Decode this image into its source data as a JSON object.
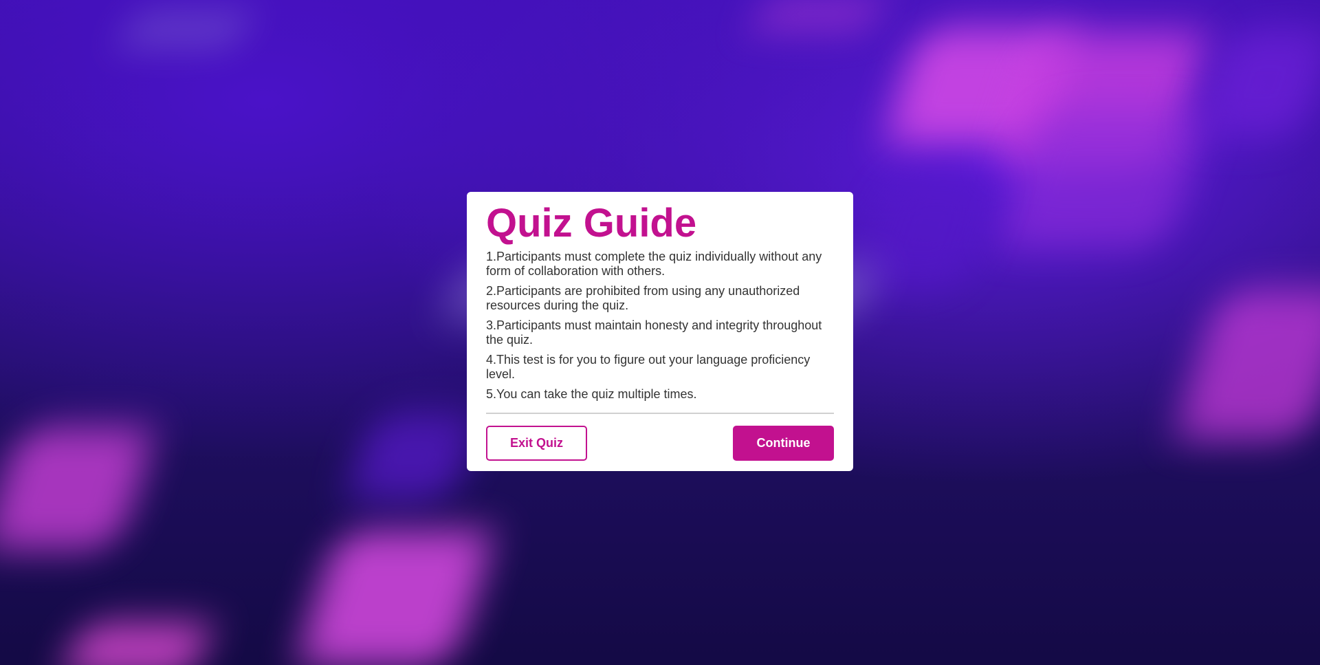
{
  "modal": {
    "title": "Quiz Guide",
    "rules": [
      "1.Participants must complete the quiz individually without any form of collaboration with others.",
      "2.Participants are prohibited from using any unauthorized resources during the quiz.",
      "3.Participants must maintain honesty and integrity throughout the quiz.",
      "4.This test is for you to figure out your language proficiency level.",
      "5.You can take the quiz multiple times."
    ],
    "exit_label": "Exit Quiz",
    "continue_label": "Continue"
  },
  "colors": {
    "accent": "#c2118f",
    "text": "#333333",
    "background_top": "#3a0fa8",
    "background_bottom": "#140a45"
  }
}
